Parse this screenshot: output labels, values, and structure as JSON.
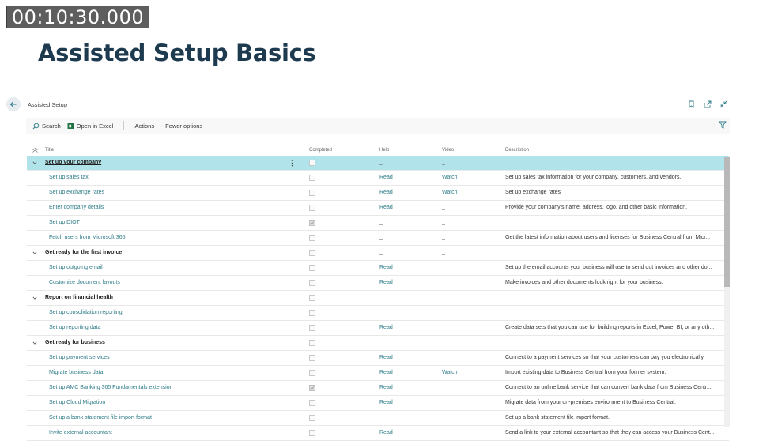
{
  "timecode": "00:10:30.000",
  "slide_title": "Assisted Setup Basics",
  "page": {
    "title": "Assisted Setup",
    "icons": [
      "bookmark-icon",
      "share-icon",
      "collapse-icon"
    ]
  },
  "actionbar": {
    "search": "Search",
    "open_in_excel": "Open in Excel",
    "actions": "Actions",
    "fewer_options": "Fewer options"
  },
  "columns": {
    "title": "Title",
    "completed": "Completed",
    "help": "Help",
    "video": "Video",
    "description": "Description"
  },
  "rows": [
    {
      "type": "group",
      "title": "Set up your company",
      "completed": false,
      "help": "_",
      "video": "_",
      "description": "",
      "selected": true
    },
    {
      "type": "item",
      "title": "Set up sales tax",
      "completed": false,
      "help": "Read",
      "video": "Watch",
      "description": "Set up sales tax information for your company, customers, and vendors."
    },
    {
      "type": "item",
      "title": "Set up exchange rates",
      "completed": false,
      "help": "Read",
      "video": "Watch",
      "description": "Set up exchange rates"
    },
    {
      "type": "item",
      "title": "Enter company details",
      "completed": false,
      "help": "Read",
      "video": "_",
      "description": "Provide your company's name, address, logo, and other basic information."
    },
    {
      "type": "item",
      "title": "Set up DIOT",
      "completed": true,
      "help": "_",
      "video": "_",
      "description": ""
    },
    {
      "type": "item",
      "title": "Fetch users from Microsoft 365",
      "completed": false,
      "help": "_",
      "video": "_",
      "description": "Get the latest information about users and licenses for Business Central from Micr..."
    },
    {
      "type": "group",
      "title": "Get ready for the first invoice",
      "completed": false,
      "help": "_",
      "video": "_",
      "description": ""
    },
    {
      "type": "item",
      "title": "Set up outgoing email",
      "completed": false,
      "help": "Read",
      "video": "_",
      "description": "Set up the email accounts your business will use to send out invoices and other do..."
    },
    {
      "type": "item",
      "title": "Customize document layouts",
      "completed": false,
      "help": "Read",
      "video": "_",
      "description": "Make invoices and other documents look right for your business."
    },
    {
      "type": "group",
      "title": "Report on financial health",
      "completed": false,
      "help": "_",
      "video": "_",
      "description": ""
    },
    {
      "type": "item",
      "title": "Set up consolidation reporting",
      "completed": false,
      "help": "_",
      "video": "_",
      "description": ""
    },
    {
      "type": "item",
      "title": "Set up reporting data",
      "completed": false,
      "help": "Read",
      "video": "_",
      "description": "Create data sets that you can use for building reports in Excel, Power BI, or any oth..."
    },
    {
      "type": "group",
      "title": "Get ready for business",
      "completed": false,
      "help": "_",
      "video": "_",
      "description": ""
    },
    {
      "type": "item",
      "title": "Set up payment services",
      "completed": false,
      "help": "Read",
      "video": "_",
      "description": "Connect to a payment services so that your customers can pay you electronically."
    },
    {
      "type": "item",
      "title": "Migrate business data",
      "completed": false,
      "help": "Read",
      "video": "Watch",
      "description": "Import existing data to Business Central from your former system."
    },
    {
      "type": "item",
      "title": "Set up AMC Banking 365 Fundamentals extension",
      "completed": true,
      "help": "Read",
      "video": "_",
      "description": "Connect to an online bank service that can convert bank data from Business Centr..."
    },
    {
      "type": "item",
      "title": "Set up Cloud Migration",
      "completed": false,
      "help": "Read",
      "video": "_",
      "description": "Migrate data from your on-premises environment to Business Central."
    },
    {
      "type": "item",
      "title": "Set up a bank statement file import format",
      "completed": false,
      "help": "_",
      "video": "_",
      "description": "Set up a bank statement file import format."
    },
    {
      "type": "item",
      "title": "Invite external accountant",
      "completed": false,
      "help": "Read",
      "video": "_",
      "description": "Send a link to your external accountant so that they can access your Business Cent..."
    }
  ],
  "colors": {
    "selected_row": "#b1e4ea",
    "link": "#2d7b87",
    "title_text": "#1d3a4f"
  }
}
